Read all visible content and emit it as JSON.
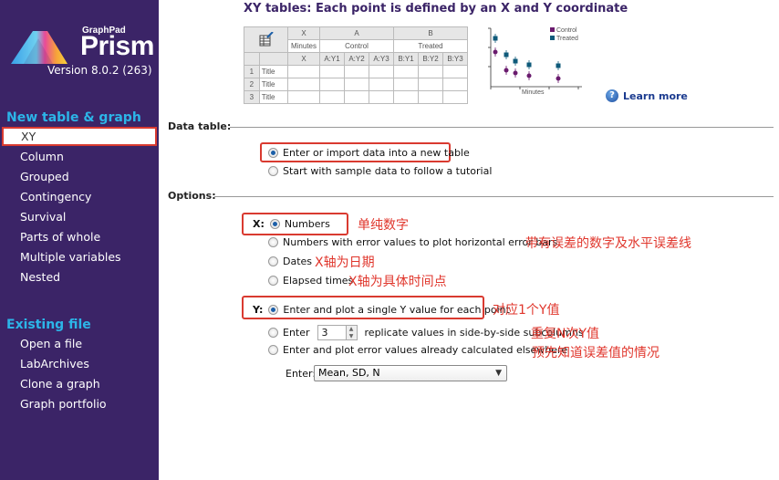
{
  "app": {
    "brand_small": "GraphPad",
    "brand_large": "Prism",
    "version": "Version 8.0.2 (263)"
  },
  "sidebar": {
    "new_section_title": "New table & graph",
    "new_items": [
      {
        "label": "XY",
        "selected": true
      },
      {
        "label": "Column"
      },
      {
        "label": "Grouped"
      },
      {
        "label": "Contingency"
      },
      {
        "label": "Survival"
      },
      {
        "label": "Parts of whole"
      },
      {
        "label": "Multiple variables"
      },
      {
        "label": "Nested"
      }
    ],
    "existing_section_title": "Existing file",
    "existing_items": [
      {
        "label": "Open a file"
      },
      {
        "label": "LabArchives"
      },
      {
        "label": "Clone a graph"
      },
      {
        "label": "Graph portfolio"
      }
    ]
  },
  "main": {
    "title": "XY tables: Each point is defined by an X and Y coordinate",
    "preview_table": {
      "group_headers": [
        "X",
        "A",
        "B"
      ],
      "group_names": [
        "Minutes",
        "Control",
        "Treated"
      ],
      "subcolumns": [
        "X",
        "A:Y1",
        "A:Y2",
        "A:Y3",
        "B:Y1",
        "B:Y2",
        "B:Y3"
      ],
      "rows": [
        {
          "num": "1",
          "title": "Title"
        },
        {
          "num": "2",
          "title": "Title"
        },
        {
          "num": "3",
          "title": "Title"
        }
      ]
    },
    "preview_chart": {
      "legend": [
        "Control",
        "Treated"
      ],
      "xlabel": "Minutes",
      "control_color": "#6a1b6e",
      "treated_color": "#0f5a7a"
    },
    "learn_more": "Learn more",
    "data_table": {
      "label": "Data table:",
      "options": [
        {
          "label": "Enter or import data into a new table",
          "selected": true
        },
        {
          "label": "Start with sample data to follow a tutorial",
          "selected": false
        }
      ]
    },
    "options": {
      "label": "Options:",
      "x_label": "X:",
      "x_options": [
        {
          "label": "Numbers",
          "selected": true,
          "annotation": "单纯数字"
        },
        {
          "label": "Numbers with error values to plot horizontal error bars",
          "selected": false,
          "annotation": "带有误差的数字及水平误差线"
        },
        {
          "label": "Dates",
          "selected": false,
          "annotation": "X轴为日期"
        },
        {
          "label": "Elapsed times",
          "selected": false,
          "annotation": "X轴为具体时间点"
        }
      ],
      "y_label": "Y:",
      "y_options": [
        {
          "label": "Enter and plot a single Y value for each point",
          "selected": true,
          "annotation": "对应1个Y值"
        },
        {
          "label_before": "Enter",
          "replicate_value": "3",
          "label_after": "replicate values in side-by-side subcolumns",
          "selected": false,
          "annotation": "重复N次Y值"
        },
        {
          "label": "Enter and plot error values already calculated elsewhere",
          "selected": false,
          "annotation": "预先知道误差值的情况"
        }
      ],
      "enter_label": "Enter:",
      "enter_value": "Mean, SD, N"
    }
  }
}
